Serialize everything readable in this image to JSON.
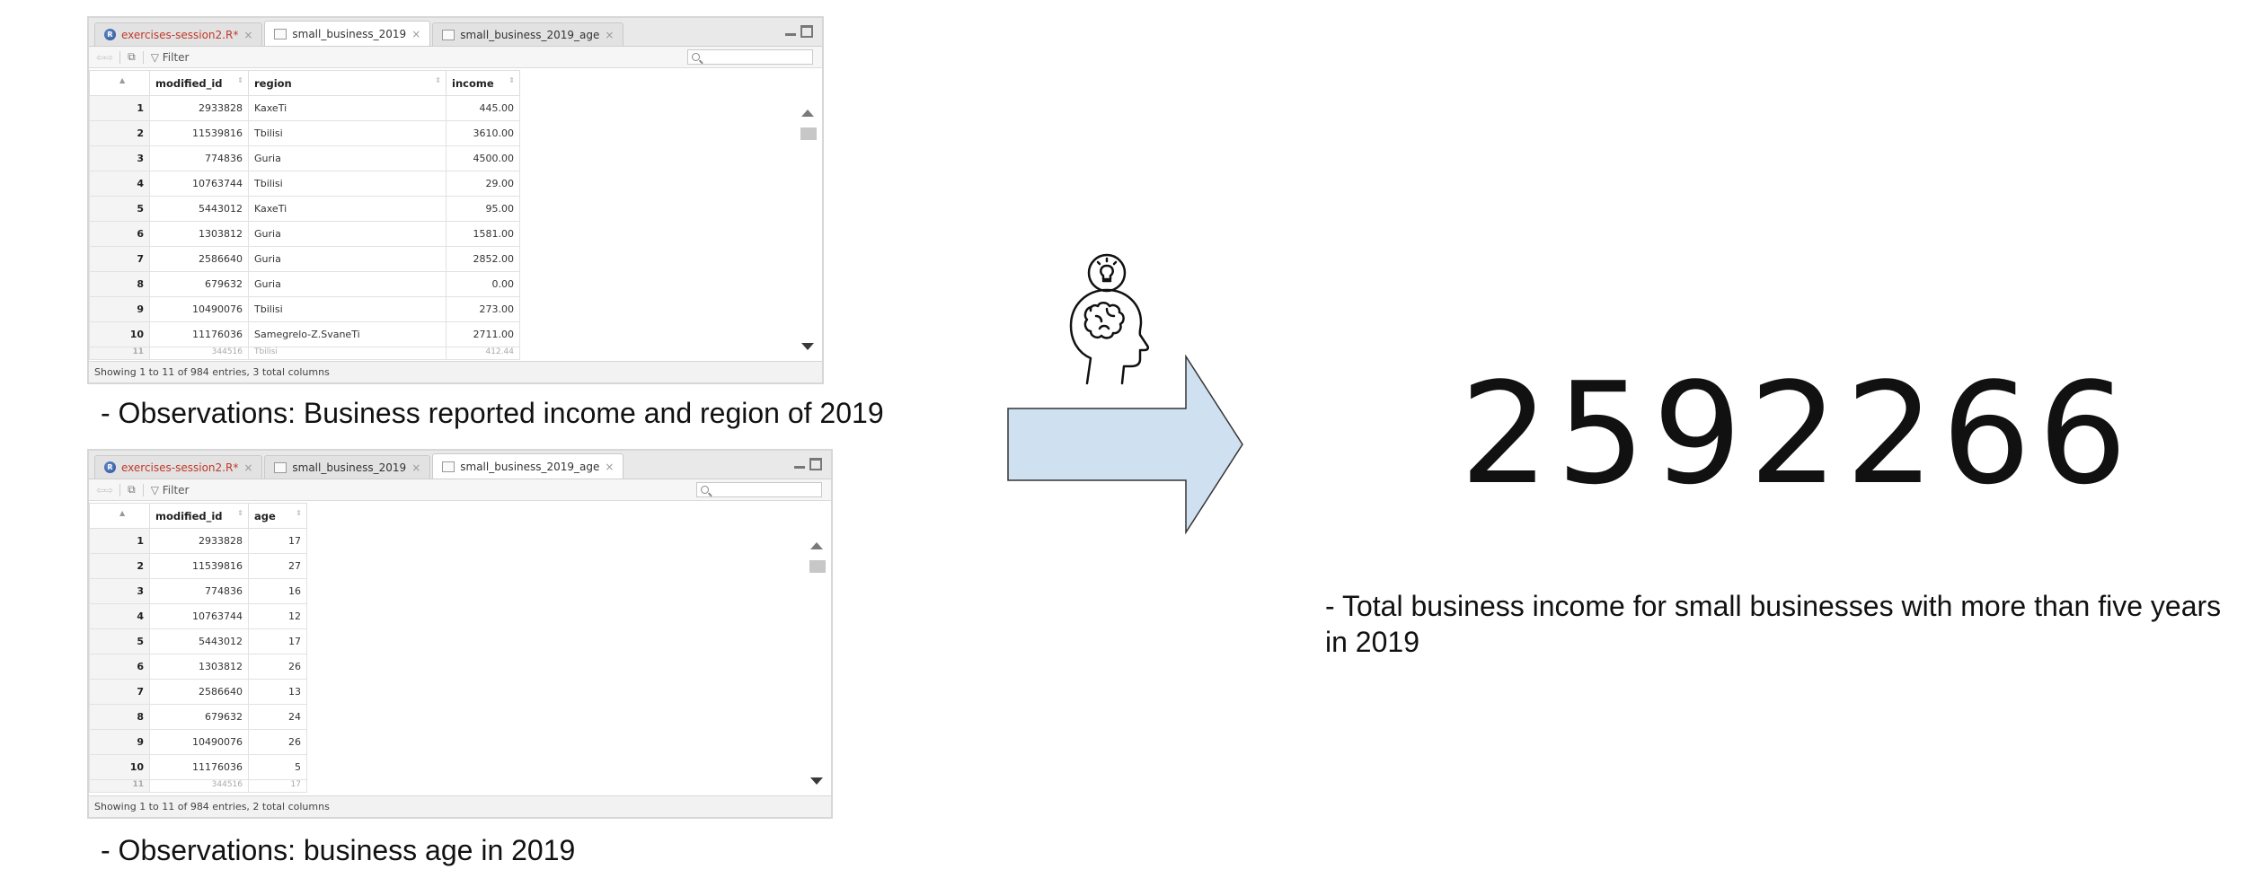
{
  "viewer1": {
    "tabs": [
      {
        "label": "exercises-session2.R*",
        "icon": "r-script-icon",
        "close": "×"
      },
      {
        "label": "small_business_2019",
        "icon": "data-table-icon",
        "close": "×"
      },
      {
        "label": "small_business_2019_age",
        "icon": "data-table-icon",
        "close": "×"
      }
    ],
    "filter_label": "Filter",
    "columns": [
      "modified_id",
      "region",
      "income"
    ],
    "rows": [
      [
        "1",
        "2933828",
        "KaxeTi",
        "445.00"
      ],
      [
        "2",
        "11539816",
        "Tbilisi",
        "3610.00"
      ],
      [
        "3",
        "774836",
        "Guria",
        "4500.00"
      ],
      [
        "4",
        "10763744",
        "Tbilisi",
        "29.00"
      ],
      [
        "5",
        "5443012",
        "KaxeTi",
        "95.00"
      ],
      [
        "6",
        "1303812",
        "Guria",
        "1581.00"
      ],
      [
        "7",
        "2586640",
        "Guria",
        "2852.00"
      ],
      [
        "8",
        "679632",
        "Guria",
        "0.00"
      ],
      [
        "9",
        "10490076",
        "Tbilisi",
        "273.00"
      ],
      [
        "10",
        "11176036",
        "Samegrelo-Z.SvaneTi",
        "2711.00"
      ]
    ],
    "partial_row": [
      "11",
      "344516",
      "Tbilisi",
      "412.44"
    ],
    "status": "Showing 1 to 11 of 984 entries, 3 total columns"
  },
  "viewer2": {
    "tabs": [
      {
        "label": "exercises-session2.R*",
        "icon": "r-script-icon",
        "close": "×"
      },
      {
        "label": "small_business_2019",
        "icon": "data-table-icon",
        "close": "×"
      },
      {
        "label": "small_business_2019_age",
        "icon": "data-table-icon",
        "close": "×"
      }
    ],
    "filter_label": "Filter",
    "columns": [
      "modified_id",
      "age"
    ],
    "rows": [
      [
        "1",
        "2933828",
        "17"
      ],
      [
        "2",
        "11539816",
        "27"
      ],
      [
        "3",
        "774836",
        "16"
      ],
      [
        "4",
        "10763744",
        "12"
      ],
      [
        "5",
        "5443012",
        "17"
      ],
      [
        "6",
        "1303812",
        "26"
      ],
      [
        "7",
        "2586640",
        "13"
      ],
      [
        "8",
        "679632",
        "24"
      ],
      [
        "9",
        "10490076",
        "26"
      ],
      [
        "10",
        "11176036",
        "5"
      ]
    ],
    "partial_row": [
      "11",
      "344516",
      "17"
    ],
    "status": "Showing 1 to 11 of 984 entries, 2 total columns"
  },
  "caption1": "- Observations: Business reported income and region of 2019",
  "caption2": "- Observations: business age in 2019",
  "result": {
    "number": "2592266",
    "caption": "- Total business income for small businesses with more than five years in 2019"
  },
  "colors": {
    "arrow_fill": "#cfe0f1",
    "arrow_stroke": "#333333",
    "r_tab_text": "#c0392b"
  }
}
